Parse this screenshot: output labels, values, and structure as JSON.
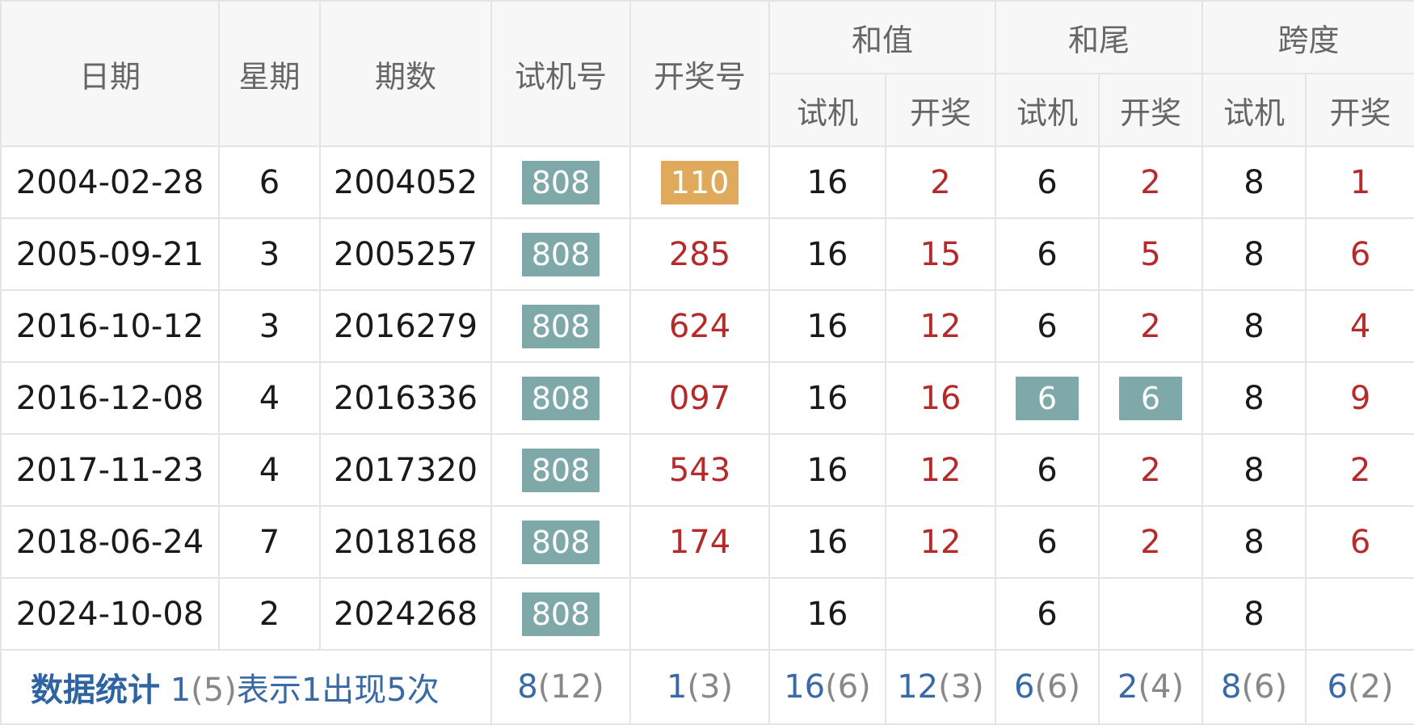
{
  "headers": {
    "date": "日期",
    "weekday": "星期",
    "period": "期数",
    "trial": "试机号",
    "draw": "开奖号",
    "sum": "和值",
    "tail": "和尾",
    "span": "跨度",
    "sub_trial": "试机",
    "sub_draw": "开奖"
  },
  "rows": [
    {
      "date": "2004-02-28",
      "weekday": "6",
      "period": "2004052",
      "trial": "808",
      "draw": "110",
      "sum_trial": "16",
      "sum_draw": "2",
      "tail_trial": "6",
      "tail_draw": "2",
      "span_trial": "8",
      "span_draw": "1"
    },
    {
      "date": "2005-09-21",
      "weekday": "3",
      "period": "2005257",
      "trial": "808",
      "draw": "285",
      "sum_trial": "16",
      "sum_draw": "15",
      "tail_trial": "6",
      "tail_draw": "5",
      "span_trial": "8",
      "span_draw": "6"
    },
    {
      "date": "2016-10-12",
      "weekday": "3",
      "period": "2016279",
      "trial": "808",
      "draw": "624",
      "sum_trial": "16",
      "sum_draw": "12",
      "tail_trial": "6",
      "tail_draw": "2",
      "span_trial": "8",
      "span_draw": "4"
    },
    {
      "date": "2016-12-08",
      "weekday": "4",
      "period": "2016336",
      "trial": "808",
      "draw": "097",
      "sum_trial": "16",
      "sum_draw": "16",
      "tail_trial": "6",
      "tail_draw": "6",
      "span_trial": "8",
      "span_draw": "9"
    },
    {
      "date": "2017-11-23",
      "weekday": "4",
      "period": "2017320",
      "trial": "808",
      "draw": "543",
      "sum_trial": "16",
      "sum_draw": "12",
      "tail_trial": "6",
      "tail_draw": "2",
      "span_trial": "8",
      "span_draw": "2"
    },
    {
      "date": "2018-06-24",
      "weekday": "7",
      "period": "2018168",
      "trial": "808",
      "draw": "174",
      "sum_trial": "16",
      "sum_draw": "12",
      "tail_trial": "6",
      "tail_draw": "2",
      "span_trial": "8",
      "span_draw": "6"
    },
    {
      "date": "2024-10-08",
      "weekday": "2",
      "period": "2024268",
      "trial": "808",
      "draw": "",
      "sum_trial": "16",
      "sum_draw": "",
      "tail_trial": "6",
      "tail_draw": "",
      "span_trial": "8",
      "span_draw": ""
    }
  ],
  "stats": {
    "title": "数据统计",
    "legend_value": "1",
    "legend_count": "(5)",
    "legend_text": "表示1出现5次",
    "trial": {
      "value": "8",
      "count": "(12)"
    },
    "draw": {
      "value": "1",
      "count": "(3)"
    },
    "sum_trial": {
      "value": "16",
      "count": "(6)"
    },
    "sum_draw": {
      "value": "12",
      "count": "(3)"
    },
    "tail_trial": {
      "value": "6",
      "count": "(6)"
    },
    "tail_draw": {
      "value": "2",
      "count": "(4)"
    },
    "span_trial": {
      "value": "8",
      "count": "(6)"
    },
    "span_draw": {
      "value": "6",
      "count": "(2)"
    }
  },
  "colors": {
    "highlight_teal": "#7fa9a8",
    "highlight_gold": "#e0aa5d",
    "draw_red": "#b52a2a",
    "stats_blue": "#3a6aa6"
  }
}
